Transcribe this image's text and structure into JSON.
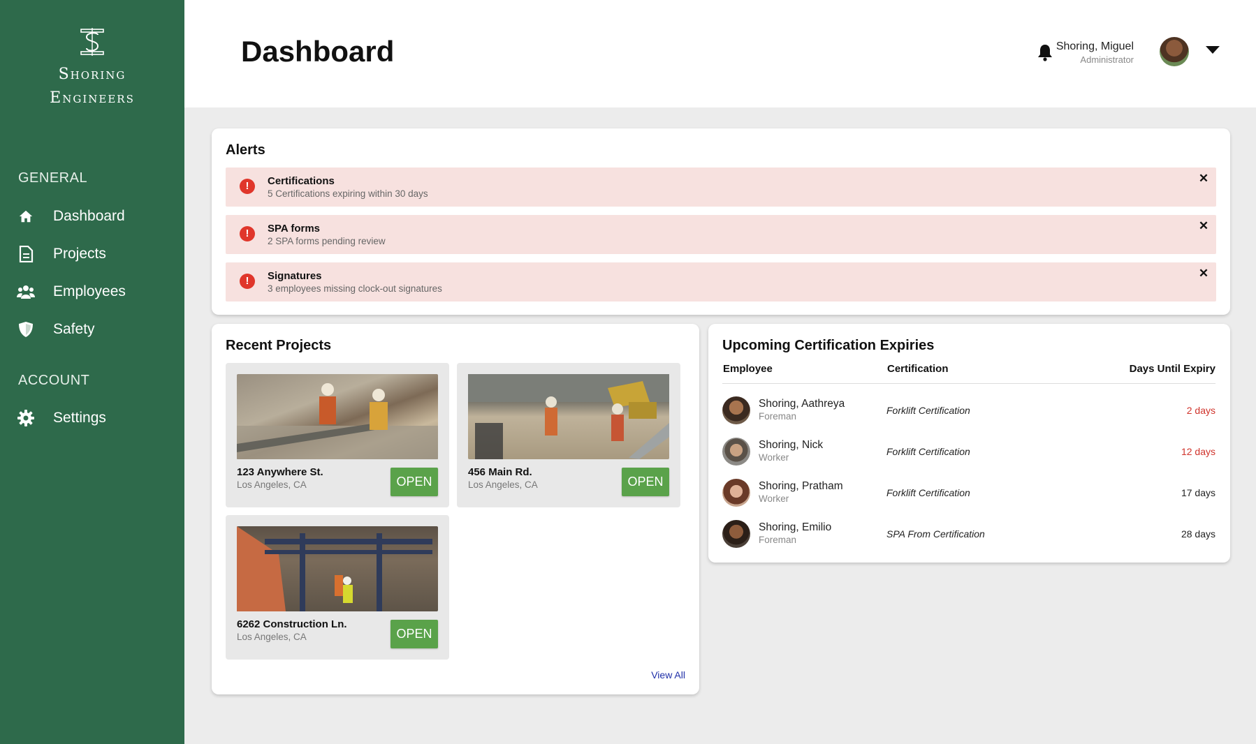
{
  "brand": {
    "line1": "Shoring",
    "line2": "Engineers"
  },
  "sidebar": {
    "general_label": "GENERAL",
    "account_label": "ACCOUNT",
    "items": [
      {
        "label": "Dashboard",
        "icon": "home-icon"
      },
      {
        "label": "Projects",
        "icon": "document-icon"
      },
      {
        "label": "Employees",
        "icon": "users-icon"
      },
      {
        "label": "Safety",
        "icon": "shield-icon"
      }
    ],
    "account_items": [
      {
        "label": "Settings",
        "icon": "gear-icon"
      }
    ]
  },
  "header": {
    "title": "Dashboard",
    "user_name": "Shoring, Miguel",
    "user_role": "Administrator"
  },
  "alerts": {
    "title": "Alerts",
    "items": [
      {
        "title": "Certifications",
        "desc": "5 Certifications expiring within 30 days"
      },
      {
        "title": "SPA forms",
        "desc": "2 SPA forms pending review"
      },
      {
        "title": "Signatures",
        "desc": "3 employees missing clock-out signatures"
      }
    ]
  },
  "projects": {
    "title": "Recent Projects",
    "view_all": "View All",
    "items": [
      {
        "name": "123 Anywhere St.",
        "location": "Los Angeles, CA",
        "button": "OPEN"
      },
      {
        "name": "456 Main Rd.",
        "location": "Los Angeles, CA",
        "button": "OPEN"
      },
      {
        "name": "6262 Construction Ln.",
        "location": "Los Angeles, CA",
        "button": "OPEN"
      }
    ]
  },
  "certs": {
    "title": "Upcoming Certification Expiries",
    "columns": [
      "Employee",
      "Certification",
      "Days Until Expiry"
    ],
    "rows": [
      {
        "name": "Shoring, Aathreya",
        "role": "Foreman",
        "cert": "Forklift Certification",
        "days": "2 days",
        "urgent": true
      },
      {
        "name": "Shoring, Nick",
        "role": "Worker",
        "cert": "Forklift Certification",
        "days": "12 days",
        "urgent": true
      },
      {
        "name": "Shoring, Pratham",
        "role": "Worker",
        "cert": "Forklift Certification",
        "days": "17 days",
        "urgent": false
      },
      {
        "name": "Shoring, Emilio",
        "role": "Foreman",
        "cert": "SPA From Certification",
        "days": "28 days",
        "urgent": false
      }
    ]
  },
  "colors": {
    "sidebar": "#2e6a4b",
    "open_button": "#5aa24a",
    "alert_bg": "#f7e1df",
    "urgent": "#d0332b",
    "link": "#1f2fa8"
  }
}
